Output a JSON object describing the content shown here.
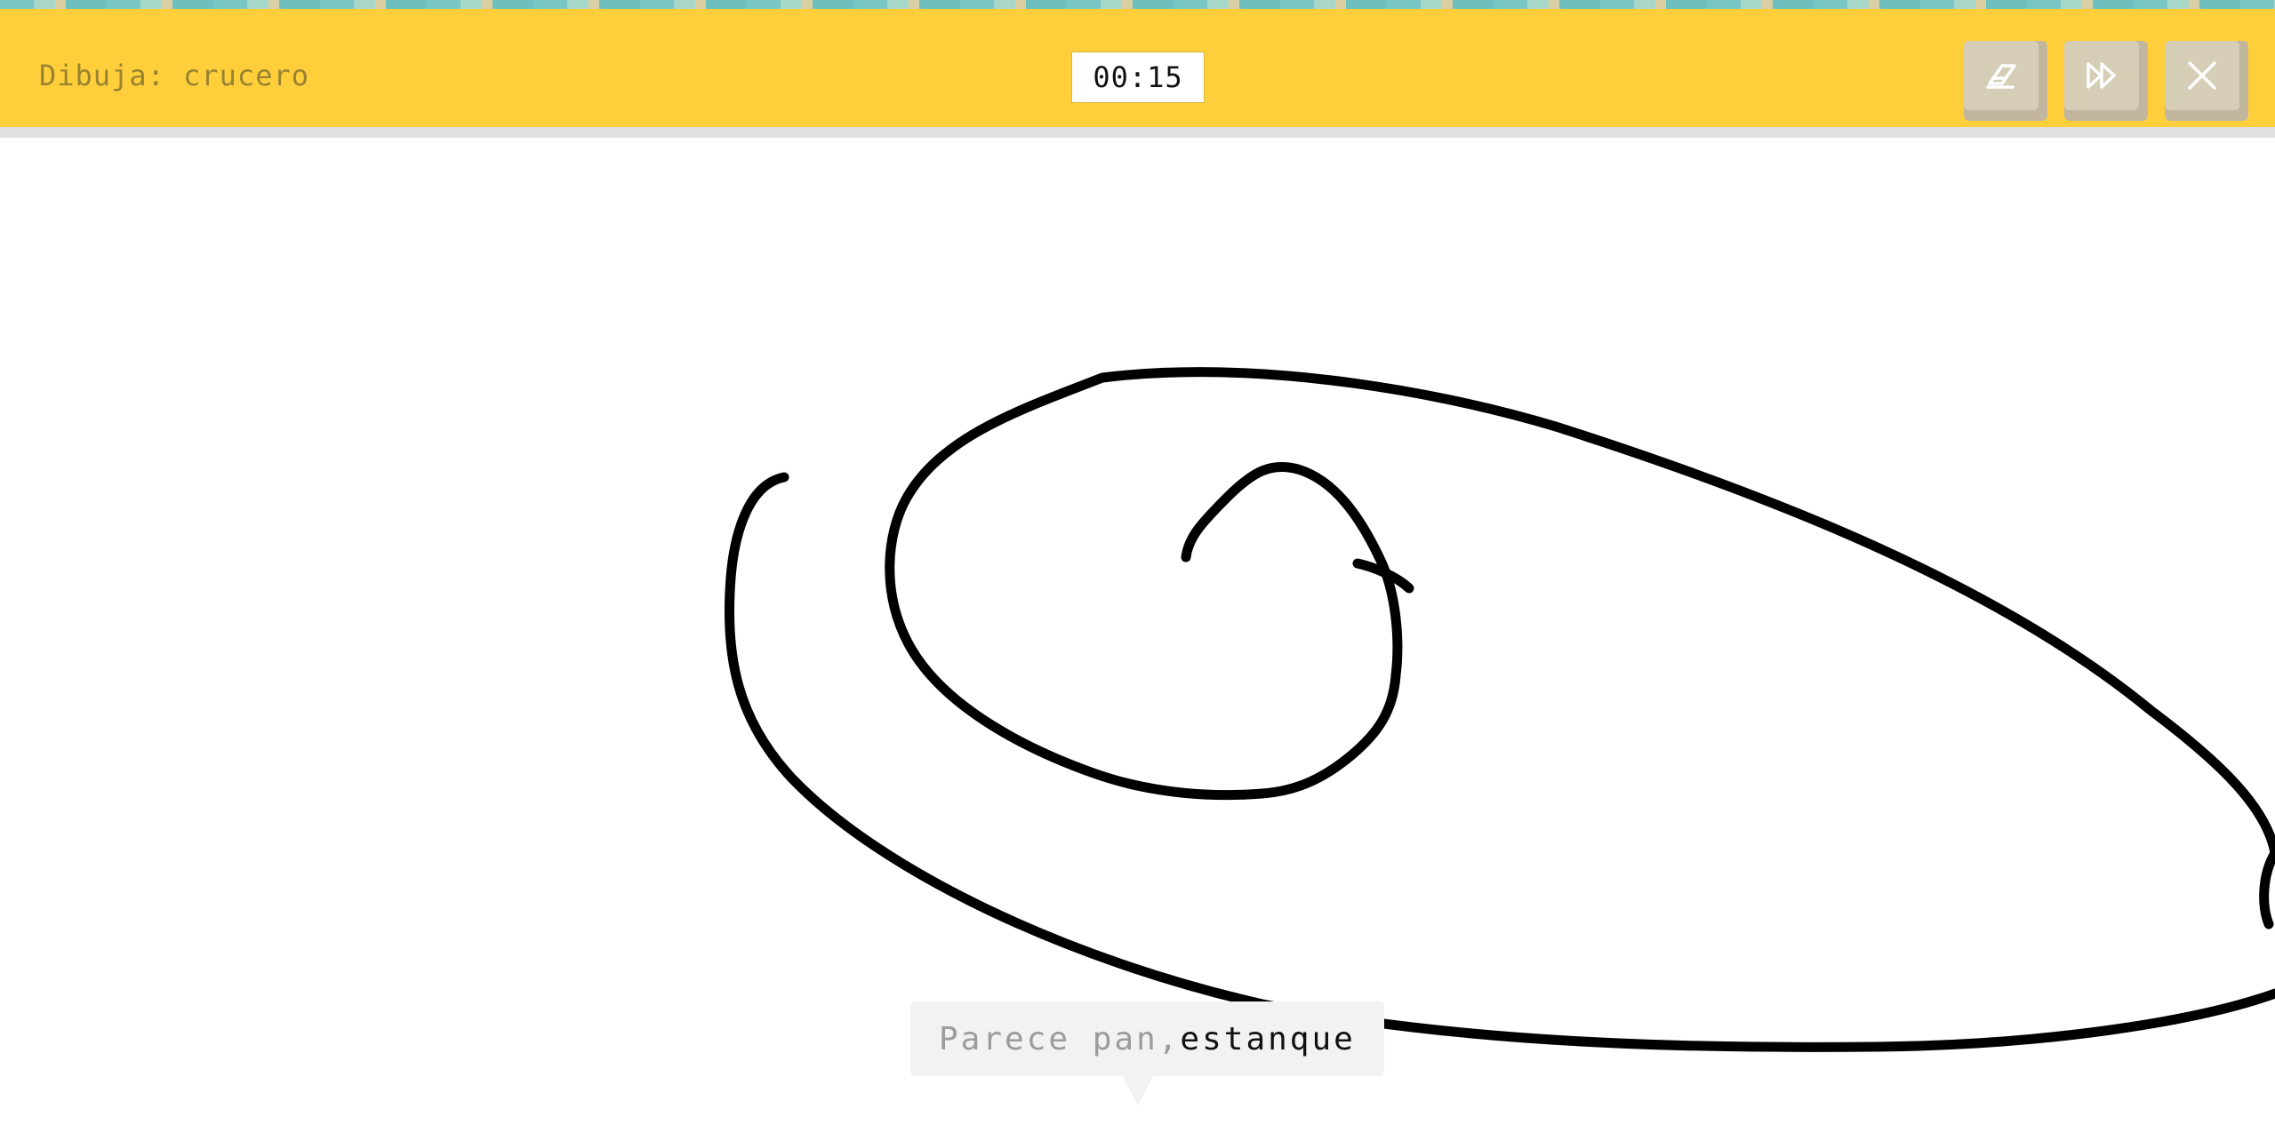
{
  "toolbar": {
    "prompt": "Dibuja: crucero",
    "timer": "00:15",
    "buttons": [
      {
        "name": "eraser-button",
        "icon": "eraser-icon"
      },
      {
        "name": "skip-button",
        "icon": "fast-forward-icon"
      },
      {
        "name": "close-button",
        "icon": "close-icon"
      }
    ]
  },
  "guess": {
    "prefix": "Parece pan, ",
    "word": "estanque"
  },
  "colors": {
    "toolbar": "#fecf3b",
    "button_face": "#d5cdb6",
    "button_shadow": "#c2b79e",
    "stroke": "#000000",
    "bubble": "#f2f2f2"
  }
}
